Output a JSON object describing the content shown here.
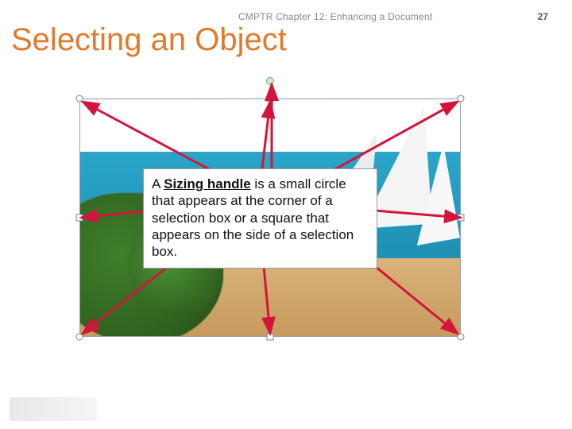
{
  "header": {
    "chapter": "CMPTR Chapter 12: Enhancing a Document",
    "page_number": "27"
  },
  "title": "Selecting an Object",
  "callout": {
    "lead": "A ",
    "term": "Sizing handle",
    "rest": " is a small circle that appears at the corner of a selection box or a square that appears on the side of a selection box."
  },
  "colors": {
    "title": "#e17a2a",
    "arrow": "#d4153b"
  }
}
